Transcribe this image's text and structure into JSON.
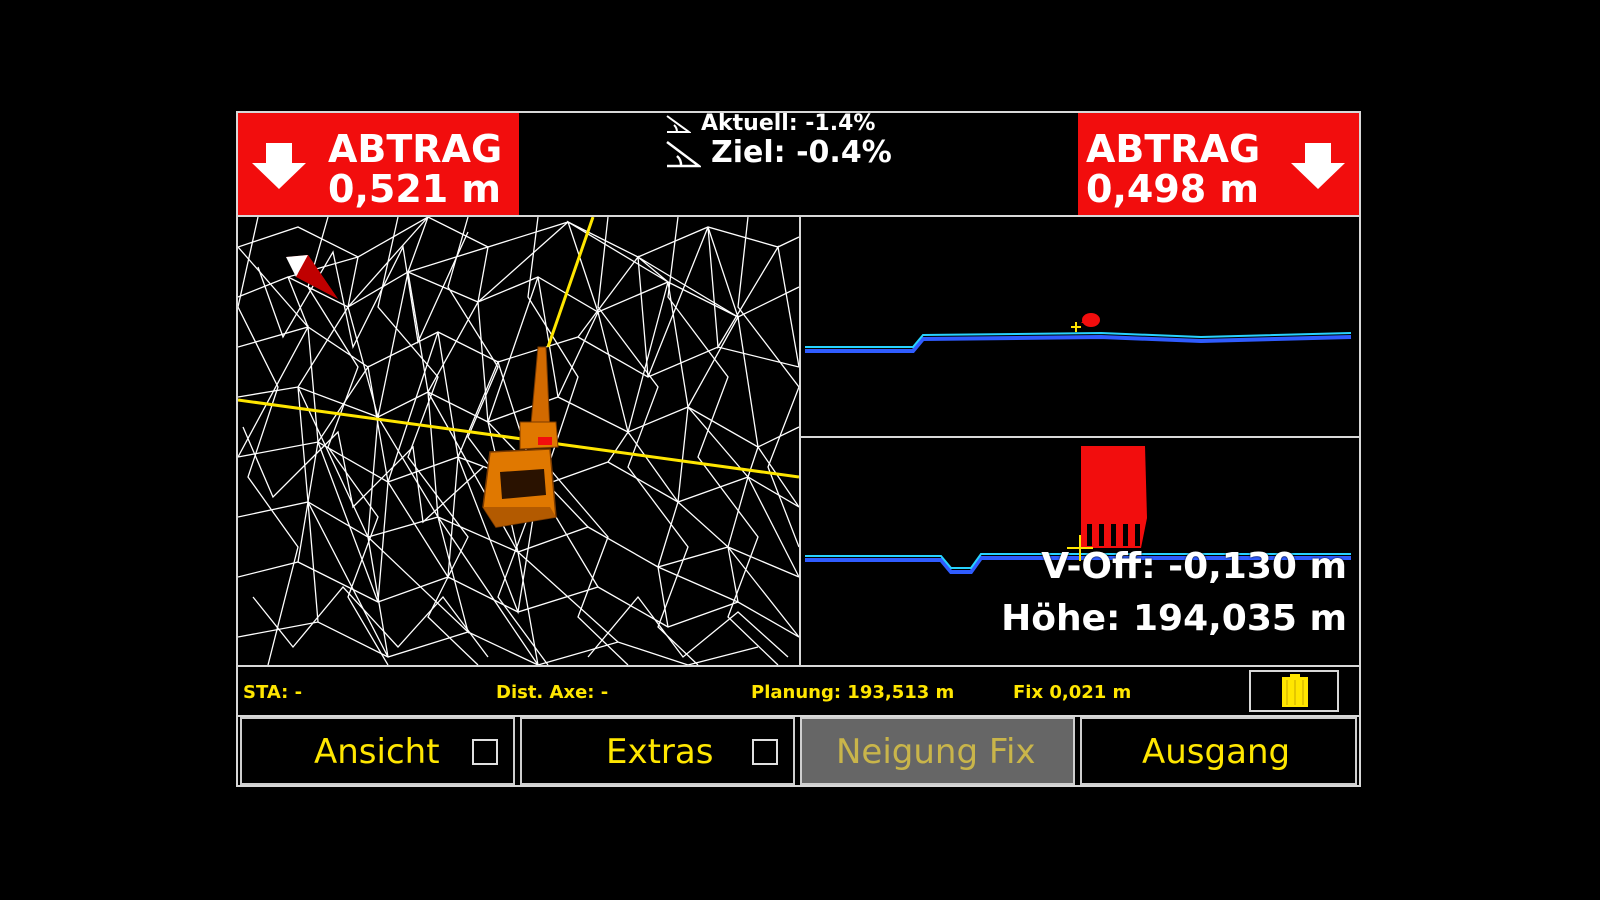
{
  "header": {
    "left": {
      "title": "ABTRAG",
      "value": "0,521 m"
    },
    "right": {
      "title": "ABTRAG",
      "value": "0,498 m"
    },
    "slope": {
      "current": "Aktuell: -1.4%",
      "target": "Ziel: -0.4%"
    },
    "colors": {
      "alert": "#f20d0d"
    }
  },
  "profile": {
    "v_off": "V-Off: -0,130 m",
    "hoehe": "Höhe: 194,035 m"
  },
  "status": {
    "sta": "STA: -",
    "dist_axe": "Dist. Axe: -",
    "planung": "Planung: 193,513 m",
    "fix": "Fix 0,021 m",
    "battery_icon": "battery-icon"
  },
  "buttons": {
    "ansicht": "Ansicht",
    "extras": "Extras",
    "neigung_fix": "Neigung Fix",
    "ausgang": "Ausgang"
  }
}
